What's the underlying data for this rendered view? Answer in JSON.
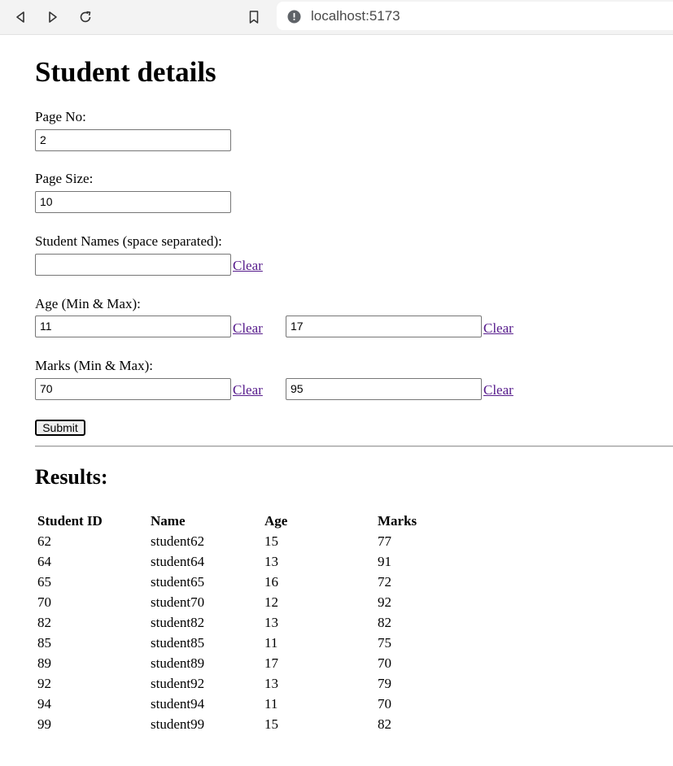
{
  "browser": {
    "url": "localhost:5173"
  },
  "page": {
    "title": "Student details",
    "page_no": {
      "label": "Page No:",
      "value": "2"
    },
    "page_size": {
      "label": "Page Size:",
      "value": "10"
    },
    "student_names": {
      "label": "Student Names (space separated):",
      "value": "",
      "clear_label": "Clear"
    },
    "age": {
      "label": "Age (Min & Max):",
      "min": "11",
      "max": "17",
      "clear_label": "Clear"
    },
    "marks": {
      "label": "Marks (Min & Max):",
      "min": "70",
      "max": "95",
      "clear_label": "Clear"
    },
    "submit_label": "Submit"
  },
  "results": {
    "title": "Results:",
    "headers": [
      "Student ID",
      "Name",
      "Age",
      "Marks"
    ],
    "rows": [
      [
        "62",
        "student62",
        "15",
        "77"
      ],
      [
        "64",
        "student64",
        "13",
        "91"
      ],
      [
        "65",
        "student65",
        "16",
        "72"
      ],
      [
        "70",
        "student70",
        "12",
        "92"
      ],
      [
        "82",
        "student82",
        "13",
        "82"
      ],
      [
        "85",
        "student85",
        "11",
        "75"
      ],
      [
        "89",
        "student89",
        "17",
        "70"
      ],
      [
        "92",
        "student92",
        "13",
        "79"
      ],
      [
        "94",
        "student94",
        "11",
        "70"
      ],
      [
        "99",
        "student99",
        "15",
        "82"
      ]
    ]
  }
}
